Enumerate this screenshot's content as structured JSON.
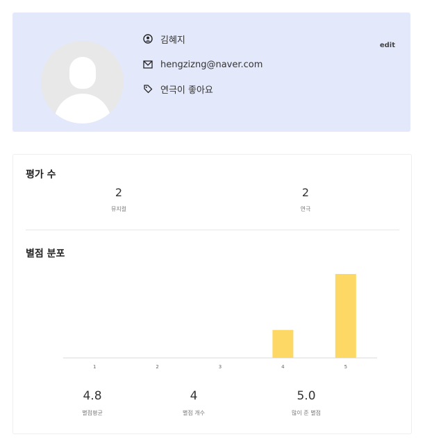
{
  "profile": {
    "name": "김혜지",
    "email": "hengzizng@naver.com",
    "tagline": "연극이 좋아요",
    "edit_label": "edit"
  },
  "rating_count": {
    "title": "평가 수",
    "items": [
      {
        "value": "2",
        "label": "뮤지컬"
      },
      {
        "value": "2",
        "label": "연극"
      }
    ]
  },
  "rating_distribution": {
    "title": "별점 분포"
  },
  "chart_data": {
    "type": "bar",
    "categories": [
      "1",
      "2",
      "3",
      "4",
      "5"
    ],
    "values": [
      0,
      0,
      0,
      1,
      3
    ],
    "color": "#fdd865"
  },
  "summary": [
    {
      "value": "4.8",
      "label": "별점평균"
    },
    {
      "value": "4",
      "label": "별점 개수"
    },
    {
      "value": "5.0",
      "label": "많이 준 별점"
    }
  ]
}
